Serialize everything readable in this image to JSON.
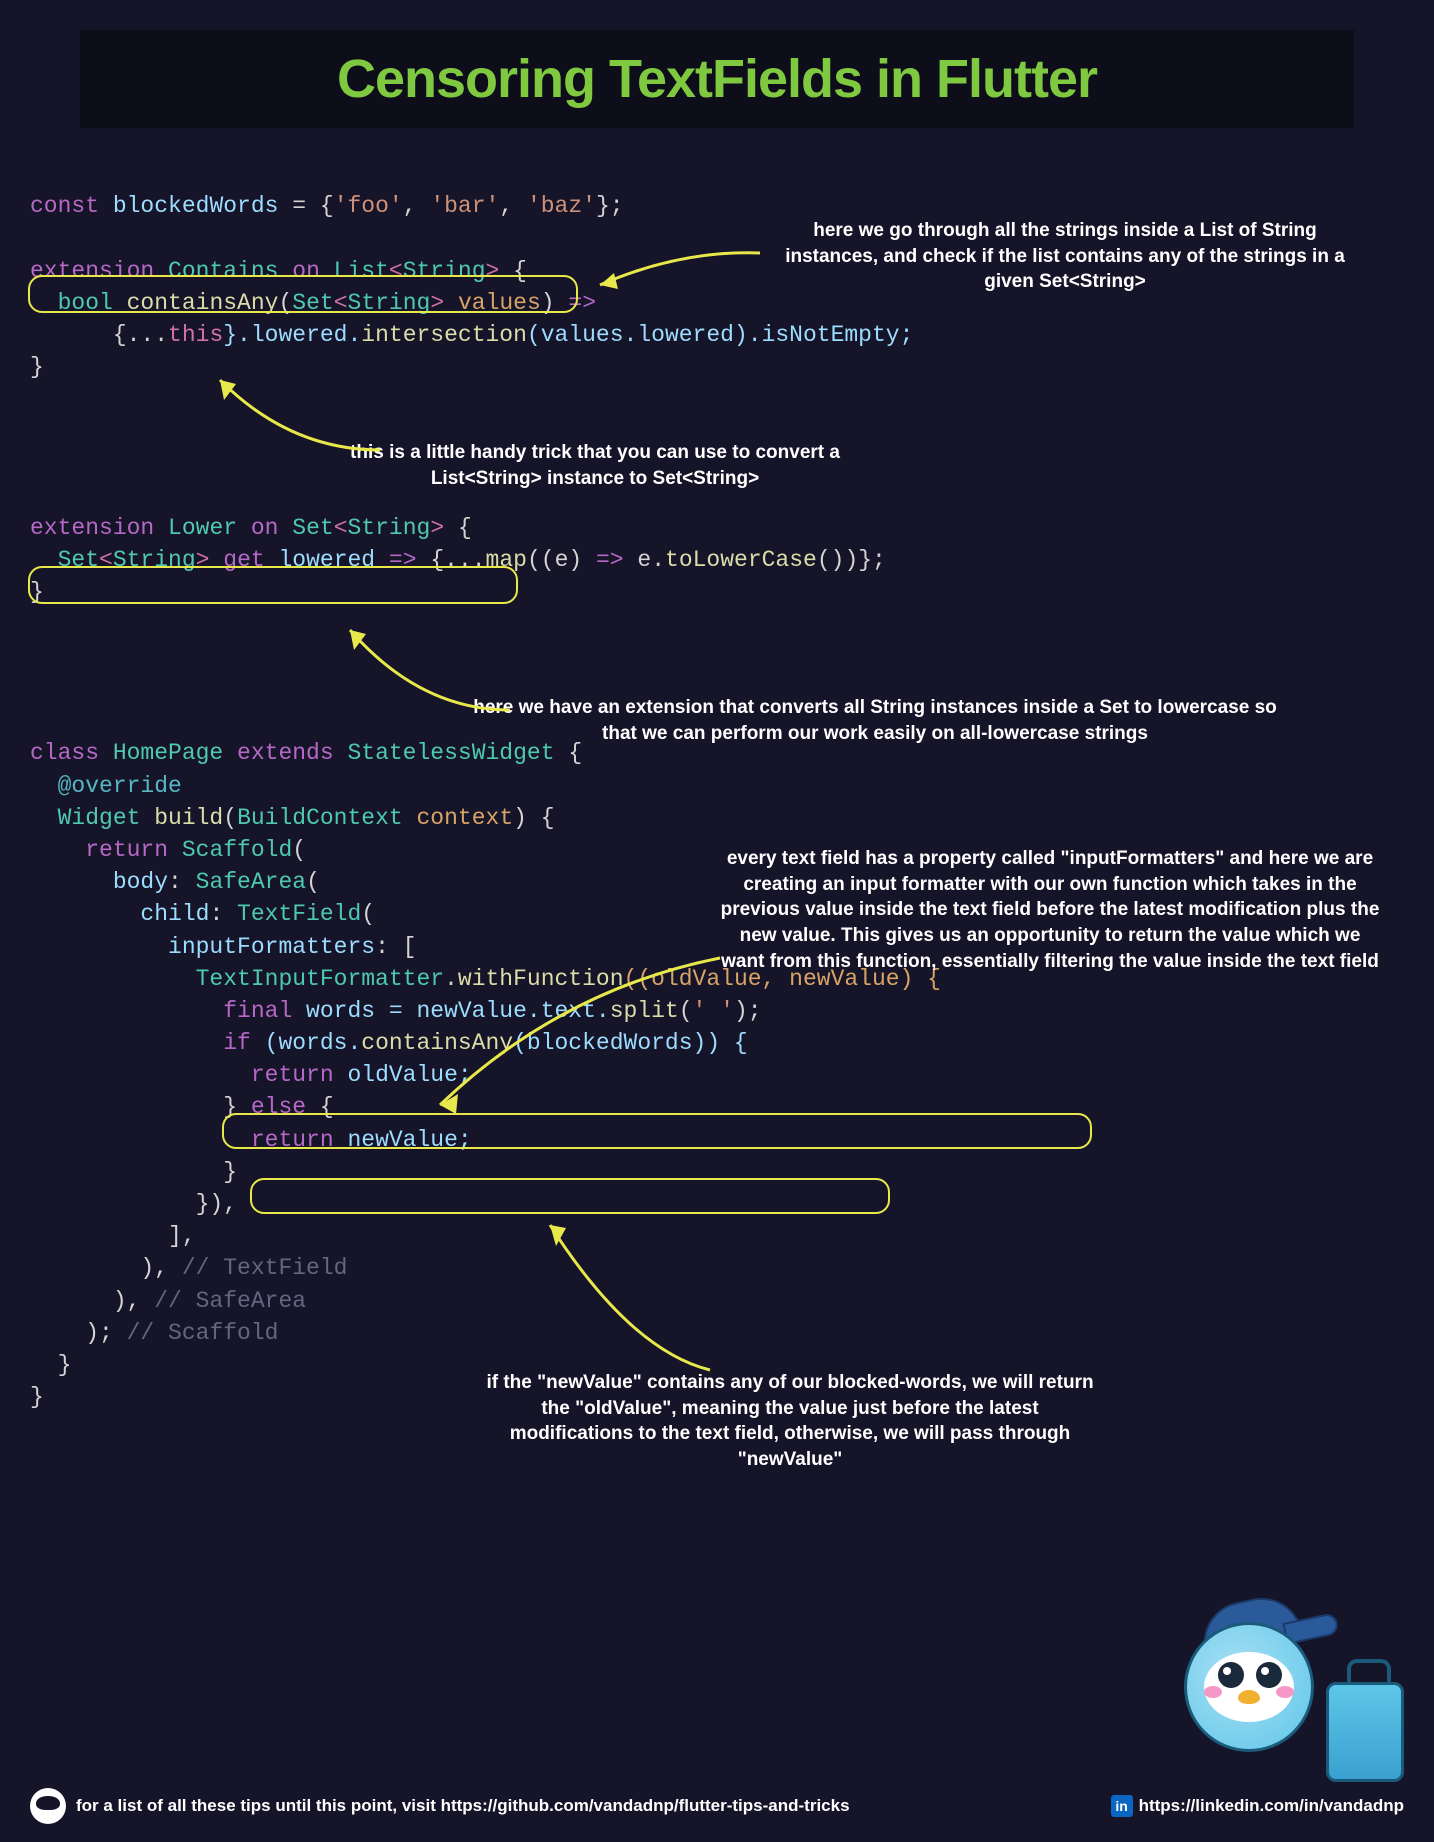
{
  "title": "Censoring TextFields in Flutter",
  "code": {
    "line1_const": "const",
    "line1_var": "blockedWords",
    "line1_eq": " = {",
    "line1_s1": "'foo'",
    "line1_c1": ", ",
    "line1_s2": "'bar'",
    "line1_c2": ", ",
    "line1_s3": "'baz'",
    "line1_end": "};",
    "ext1_kw": "extension",
    "ext1_name": " Contains ",
    "ext1_on": "on",
    "ext1_type": " List",
    "ext1_ang1": "<",
    "ext1_str": "String",
    "ext1_ang2": ">",
    "ext1_brace": " {",
    "ext1_ret": "  bool",
    "ext1_fn": " containsAny",
    "ext1_paren1": "(",
    "ext1_pt": "Set",
    "ext1_pang1": "<",
    "ext1_pstr": "String",
    "ext1_pang2": ">",
    "ext1_pv": " values",
    "ext1_paren2": ") ",
    "ext1_arrow": "=>",
    "ext1_body1": "      {...",
    "ext1_this": "this",
    "ext1_body2": "}.lowered.",
    "ext1_inter": "intersection",
    "ext1_body3": "(values.lowered).isNotEmpty;",
    "ext1_close": "}",
    "ext2_kw": "extension",
    "ext2_name": " Lower ",
    "ext2_on": "on",
    "ext2_type": " Set",
    "ext2_ang1": "<",
    "ext2_str": "String",
    "ext2_ang2": ">",
    "ext2_brace": " {",
    "ext2_ret": "  Set",
    "ext2_rang1": "<",
    "ext2_rstr": "String",
    "ext2_rang2": ">",
    "ext2_get": " get",
    "ext2_prop": " lowered ",
    "ext2_arrow": "=>",
    "ext2_body1": " {...",
    "ext2_map": "map",
    "ext2_body2": "((e) ",
    "ext2_ar2": "=>",
    "ext2_body3": " e.",
    "ext2_tlc": "toLowerCase",
    "ext2_body4": "())};",
    "ext2_close": "}",
    "cls_kw": "class",
    "cls_name": " HomePage ",
    "cls_ext": "extends",
    "cls_sw": " StatelessWidget ",
    "cls_brace": "{",
    "cls_ov": "  @override",
    "cls_wt": "  Widget",
    "cls_build": " build",
    "cls_p1": "(",
    "cls_bc": "BuildContext",
    "cls_ctx": " context",
    "cls_p2": ") {",
    "cls_ret": "    return",
    "cls_scaf": " Scaffold",
    "cls_sp": "(",
    "cls_body": "      body",
    "cls_col": ": ",
    "cls_sa": "SafeArea",
    "cls_sap": "(",
    "cls_child": "        child",
    "cls_col2": ": ",
    "cls_tf": "TextField",
    "cls_tfp": "(",
    "cls_if": "          inputFormatters",
    "cls_col3": ": [",
    "cls_tif": "            TextInputFormatter",
    "cls_dot": ".",
    "cls_wf": "withFunction",
    "cls_wfp": "((oldValue, newValue) {",
    "cls_final": "              final",
    "cls_words": " words = newValue.text.",
    "cls_split": "split",
    "cls_splp": "(",
    "cls_sps": "' '",
    "cls_sple": ");",
    "cls_ifkw": "              if",
    "cls_ifc": " (words.",
    "cls_ca": "containsAny",
    "cls_cap": "(blockedWords)) {",
    "cls_r1": "                return",
    "cls_ov1": " oldValue;",
    "cls_else": "              } ",
    "cls_elsekw": "else",
    "cls_elseb": " {",
    "cls_r2": "                return",
    "cls_nv": " newValue;",
    "cls_cb1": "              }",
    "cls_cb2": "            }),",
    "cls_cb3": "          ],",
    "cls_cb4": "        ), ",
    "cls_cmt1": "// TextField",
    "cls_cb5": "      ), ",
    "cls_cmt2": "// SafeArea",
    "cls_cb6": "    ); ",
    "cls_cmt3": "// Scaffold",
    "cls_cb7": "  }",
    "cls_cb8": "}"
  },
  "annotations": {
    "a1": "here we go through all the strings inside a List of String instances, and check if the list contains any of the strings in a given Set<String>",
    "a2": "this is a little handy trick that you can use to convert a List<String> instance to Set<String>",
    "a3": "here we have an extension that converts all String instances inside a Set to lowercase so that we can perform our work easily on all-lowercase strings",
    "a4": "every text field has a property called \"inputFormatters\" and here we are creating an input formatter with our own function which takes in the previous value inside the text field before the latest modification plus the new value. This gives us an opportunity to return the value which we want from this function, essentially filtering the value inside the text field",
    "a5": "if the \"newValue\" contains any of our blocked-words, we will return the \"oldValue\", meaning the value just before the latest modifications to the text field, otherwise, we will pass through \"newValue\""
  },
  "footer": {
    "left": "for a list of all these tips until this point, visit https://github.com/vandadnp/flutter-tips-and-tricks",
    "right": "https://linkedin.com/in/vandadnp",
    "linkedin_label": "in"
  }
}
